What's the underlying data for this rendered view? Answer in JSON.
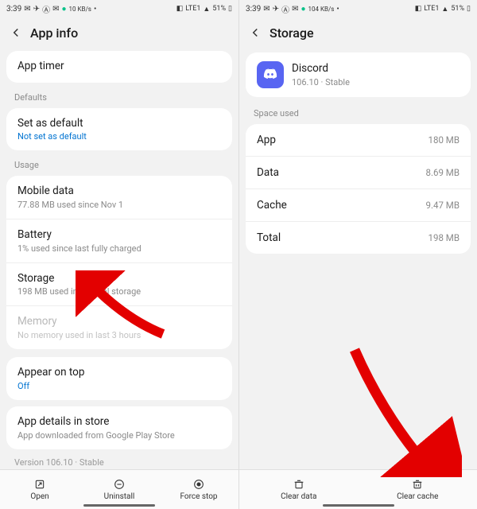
{
  "statusbar": {
    "time": "3:39",
    "net_label": "10 KB/s",
    "net_label2": "104 KB/s",
    "lte": "LTE1",
    "vol": "Vol",
    "signal": "51%"
  },
  "left": {
    "title": "App info",
    "app_timer": "App timer",
    "defaults_label": "Defaults",
    "set_default": {
      "title": "Set as default",
      "sub": "Not set as default"
    },
    "usage_label": "Usage",
    "mobile_data": {
      "title": "Mobile data",
      "sub": "77.88 MB used since Nov 1"
    },
    "battery": {
      "title": "Battery",
      "sub": "1% used since last fully charged"
    },
    "storage": {
      "title": "Storage",
      "sub": "198 MB used in Internal storage"
    },
    "memory": {
      "title": "Memory",
      "sub": "No memory used in last 3 hours"
    },
    "appear_on_top": {
      "title": "Appear on top",
      "sub": "Off"
    },
    "app_details": {
      "title": "App details in store",
      "sub": "App downloaded from Google Play Store"
    },
    "version": "Version 106.10 · Stable",
    "buttons": {
      "open": "Open",
      "uninstall": "Uninstall",
      "force_stop": "Force stop"
    }
  },
  "right": {
    "title": "Storage",
    "app": {
      "name": "Discord",
      "version": "106.10 · Stable"
    },
    "space_used_label": "Space used",
    "rows": {
      "app": {
        "k": "App",
        "v": "180 MB"
      },
      "data": {
        "k": "Data",
        "v": "8.69 MB"
      },
      "cache": {
        "k": "Cache",
        "v": "9.47 MB"
      },
      "total": {
        "k": "Total",
        "v": "198 MB"
      }
    },
    "buttons": {
      "clear_data": "Clear data",
      "clear_cache": "Clear cache"
    }
  }
}
